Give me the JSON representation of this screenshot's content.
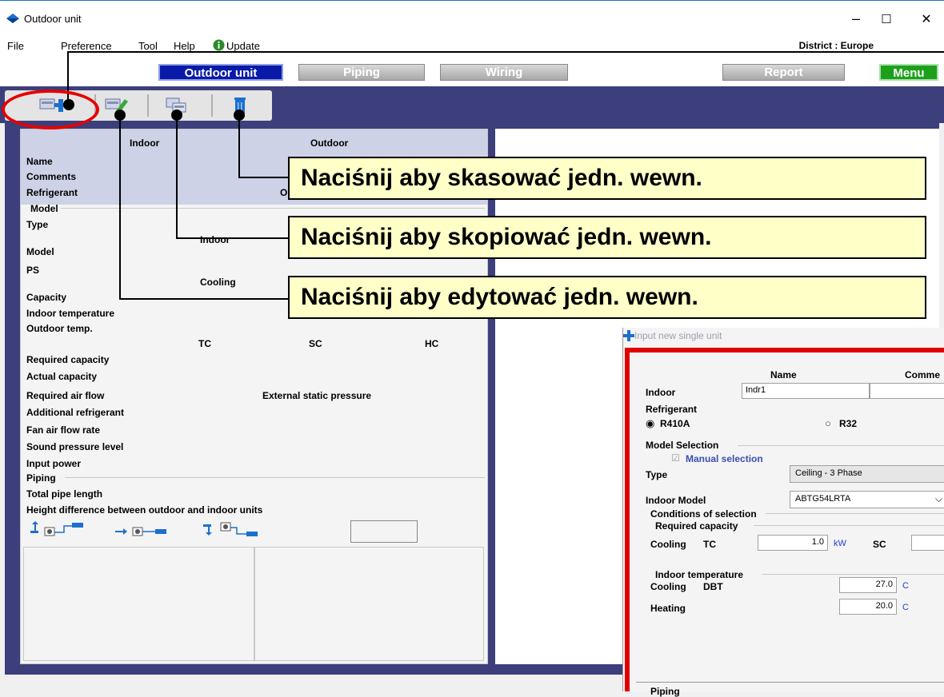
{
  "window": {
    "title": "Outdoor unit",
    "minimize": "–",
    "maximize": "☐",
    "close": "✕"
  },
  "menu": {
    "file": "File",
    "preference": "Preference",
    "tool": "Tool",
    "help": "Help",
    "update": "Update",
    "district": "District : Europe"
  },
  "tabs": {
    "outdoor": "Outdoor unit",
    "piping": "Piping",
    "wiring": "Wiring",
    "report": "Report",
    "menu": "Menu"
  },
  "panel": {
    "col_indoor": "Indoor",
    "col_outdoor": "Outdoor",
    "name": "Name",
    "comments": "Comments",
    "refrigerant": "Refrigerant",
    "refrigerant_val_partial": "O",
    "model_group": "Model",
    "type": "Type",
    "indoor_sub": "Indoor",
    "model": "Model",
    "ps": "PS",
    "cooling": "Cooling",
    "capacity": "Capacity",
    "indoor_temperature": "Indoor temperature",
    "outdoor_temp": "Outdoor temp.",
    "tc": "TC",
    "sc": "SC",
    "hc": "HC",
    "required_capacity": "Required capacity",
    "actual_capacity": "Actual capacity",
    "required_air_flow": "Required air flow",
    "external_static_pressure": "External static pressure",
    "additional_refrigerant": "Additional refrigerant",
    "fan_air_flow_rate": "Fan air flow rate",
    "sound_pressure_level": "Sound pressure level",
    "input_power": "Input power",
    "piping_group": "Piping",
    "total_pipe_length": "Total pipe length",
    "height_difference": "Height difference between outdoor and indoor units"
  },
  "callouts": {
    "delete": "Naciśnij aby skasować jedn. wewn.",
    "copy": "Naciśnij aby skopiować jedn. wewn.",
    "edit": "Naciśnij aby edytować jedn. wewn."
  },
  "dialog": {
    "title": "Input new single unit",
    "name_header": "Name",
    "comments_header": "Comme",
    "indoor_label": "Indoor",
    "indoor_name_value": "Indr1",
    "refrigerant_label": "Refrigerant",
    "r410a": "R410A",
    "r32": "R32",
    "model_selection": "Model Selection",
    "manual_selection": "Manual selection",
    "type_label": "Type",
    "type_value": "Ceiling - 3 Phase",
    "indoor_model_label": "Indoor Model",
    "indoor_model_value": "ABTG54LRTA",
    "conditions": "Conditions of selection",
    "required_capacity": "Required capacity",
    "cooling": "Cooling",
    "tc": "TC",
    "tc_value": "1.0",
    "tc_unit": "kW",
    "sc": "SC",
    "indoor_temperature": "Indoor temperature",
    "dbt": "DBT",
    "cooling_dbt_value": "27.0",
    "heating": "Heating",
    "heating_value": "20.0",
    "temp_unit": "C",
    "piping": "Piping"
  },
  "colors": {
    "accent_blue": "#0a1aa8",
    "band": "#3c3f7c",
    "callout_bg": "#ffffc8",
    "highlight_red": "#e00000",
    "menu_green": "#1ca01c"
  },
  "icons": [
    "app-icon",
    "new-unit-icon",
    "edit-unit-icon",
    "copy-unit-icon",
    "delete-unit-icon",
    "info-icon",
    "pipe-up-icon",
    "pipe-level-icon",
    "pipe-down-icon"
  ]
}
